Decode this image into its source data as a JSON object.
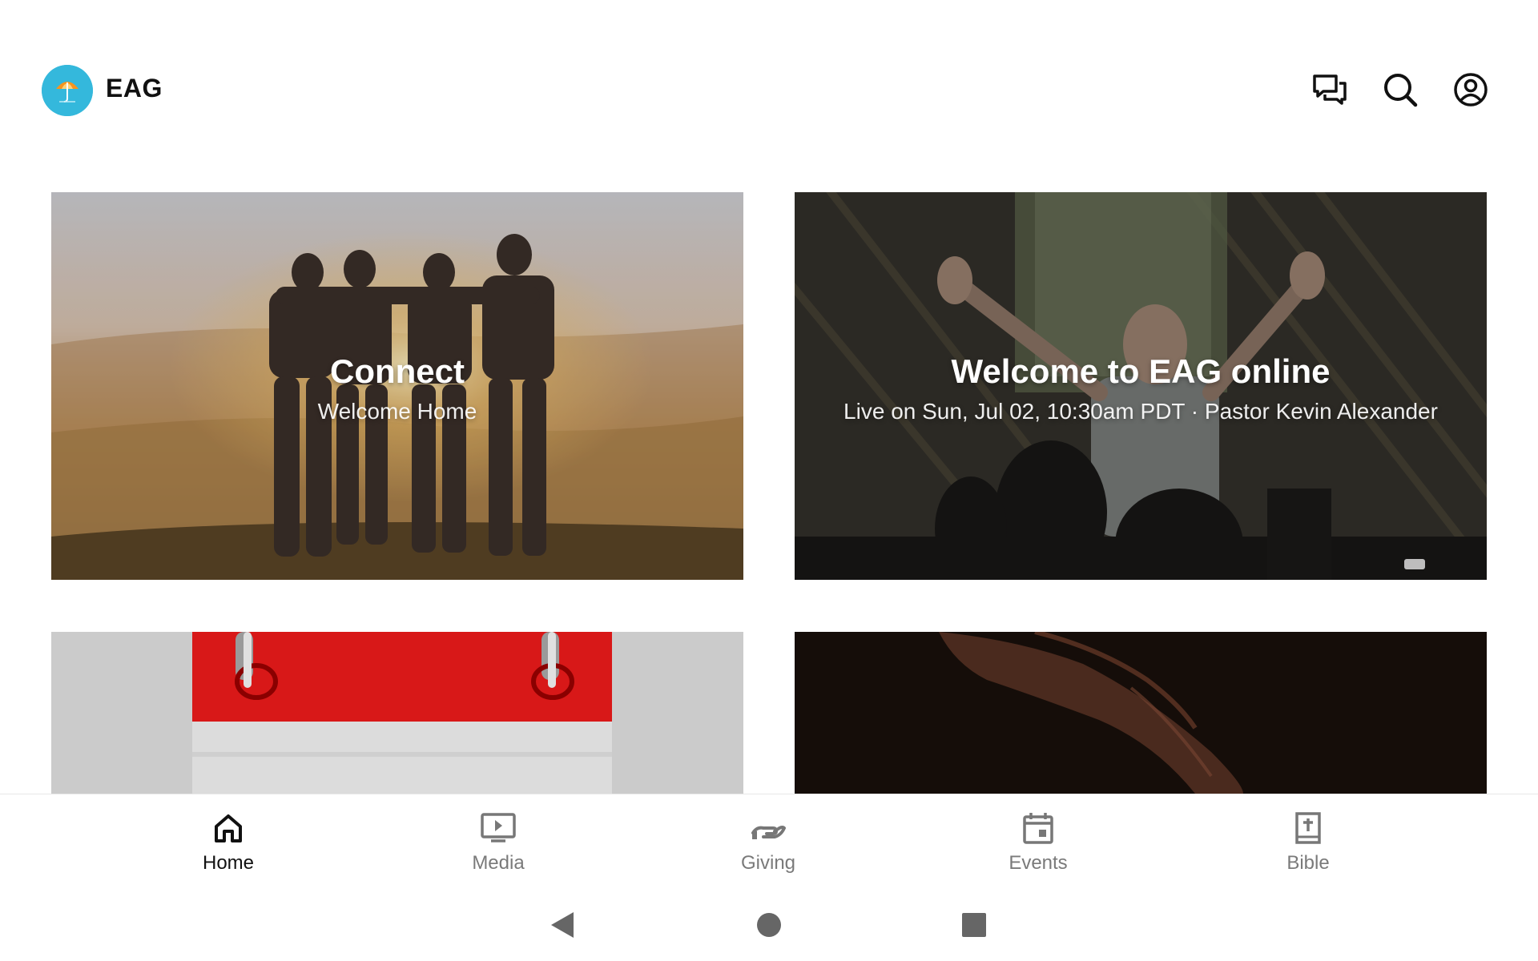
{
  "app": {
    "title": "EAG",
    "icons": [
      "chat-icon",
      "search-icon",
      "account-icon"
    ]
  },
  "cards": [
    {
      "title": "Connect",
      "subtitle": "Welcome Home"
    },
    {
      "title": "Welcome to EAG online",
      "subtitle": "Live on Sun, Jul 02, 10:30am PDT · Pastor Kevin Alexander"
    },
    {
      "title": "",
      "subtitle": ""
    },
    {
      "title": "",
      "subtitle": ""
    }
  ],
  "bottom_nav": {
    "items": [
      {
        "label": "Home",
        "icon": "home-icon",
        "active": true
      },
      {
        "label": "Media",
        "icon": "media-icon",
        "active": false
      },
      {
        "label": "Giving",
        "icon": "giving-icon",
        "active": false
      },
      {
        "label": "Events",
        "icon": "events-icon",
        "active": false
      },
      {
        "label": "Bible",
        "icon": "bible-icon",
        "active": false
      }
    ]
  },
  "colors": {
    "logo_bg": "#34b8dc",
    "active": "#111111",
    "inactive": "#7a7a7a"
  }
}
